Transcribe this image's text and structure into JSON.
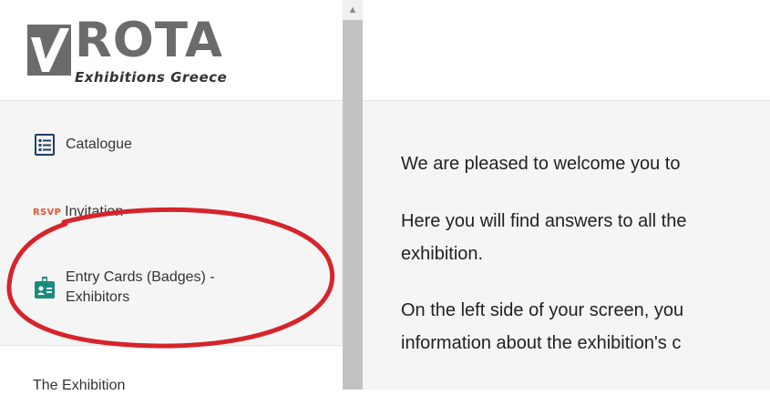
{
  "logo": {
    "brand": "ROTA",
    "tagline": "Exhibitions Greece"
  },
  "nav": {
    "items": [
      {
        "label": "Catalogue",
        "icon": "catalogue-list-icon"
      },
      {
        "label": "Invitation",
        "icon": "rsvp-icon",
        "icon_text": "RSVP"
      },
      {
        "label_line1": "Entry Cards (Badges) -",
        "label_line2": "Exhibitors",
        "icon": "badge-icon"
      }
    ]
  },
  "section": {
    "title": "The Exhibition"
  },
  "main": {
    "paragraphs": [
      "We are pleased to welcome you to",
      "Here you will find answers to all the",
      "exhibition.",
      "On the left side of your screen, you",
      "information about the exhibition's c"
    ]
  },
  "colors": {
    "teal": "#1c8a7e",
    "navy": "#1f3f66",
    "rsvp": "#e4572e",
    "annotation": "#d6242a"
  }
}
